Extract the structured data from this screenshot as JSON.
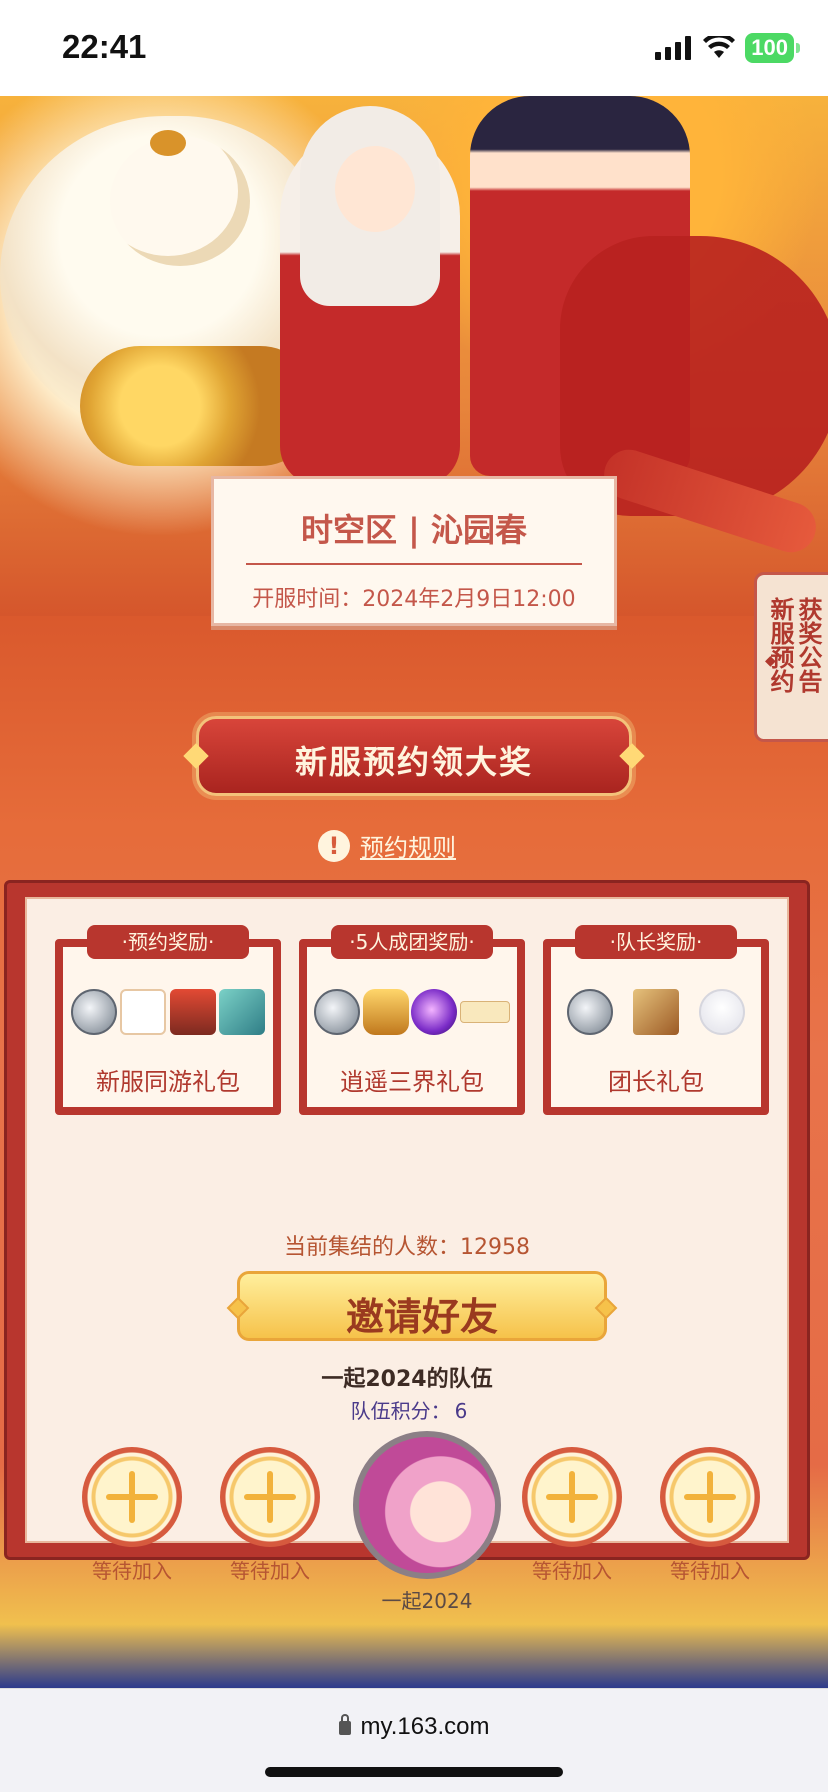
{
  "status_bar": {
    "time": "22:41",
    "battery": "100",
    "icons": [
      "signal-icon",
      "wifi-icon",
      "battery-icon"
    ]
  },
  "server": {
    "title": "时空区 | 沁园春",
    "open_time": "开服时间：2024年2月9日12:00"
  },
  "side_tab": {
    "col1": "新服预约",
    "col2": "获奖公告"
  },
  "main_banner": {
    "label": "新服预约领大奖"
  },
  "rules": {
    "label": "预约规则"
  },
  "rewards": [
    {
      "badge": "·预约奖励·",
      "name": "新服同游礼包",
      "items": [
        "coin",
        "card",
        "hero",
        "book"
      ]
    },
    {
      "badge": "·5人成团奖励·",
      "name": "逍遥三界礼包",
      "items": [
        "coin",
        "gourd",
        "orb",
        "slip"
      ]
    },
    {
      "badge": "·队长奖励·",
      "name": "团长礼包",
      "items": [
        "coin",
        "map",
        "ghost"
      ]
    }
  ],
  "gathered": {
    "label": "当前集结的人数：12958"
  },
  "invite": {
    "label": "邀请好友"
  },
  "team": {
    "name": "一起2024的队伍",
    "score_label": "队伍积分：",
    "score_value": "6",
    "leader_name": "一起2024",
    "waiting_label": "等待加入"
  },
  "browser": {
    "url": "my.163.com"
  },
  "colors": {
    "accent_red": "#b8362e",
    "gold": "#f6c24a",
    "cream": "#fbeee4"
  }
}
